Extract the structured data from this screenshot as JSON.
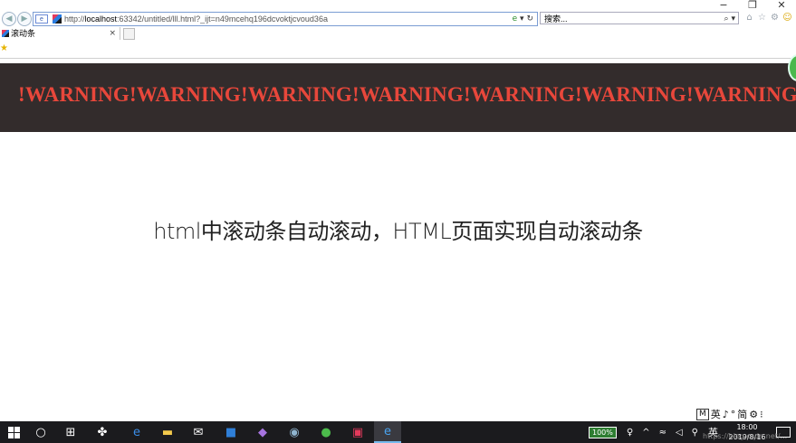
{
  "window": {
    "controls": [
      "−",
      "❐",
      "✕"
    ]
  },
  "addressbar": {
    "url_prefix": "http://",
    "url_host": "localhost",
    "url_rest": ":63342/untitled/lll.html?_ijt=n49mcehq196dcvoktjcvoud36a",
    "search_placeholder": "搜索..."
  },
  "tabs": [
    {
      "label": "滚动条"
    }
  ],
  "page": {
    "marquee_text": "!WARNING!WARNING!WARNING!WARNING!WARNING!WARNING!WARNING!WARNING",
    "headline": "html中滚动条自动滚动，HTML页面实现自动滚动条"
  },
  "ime": {
    "items": [
      "M",
      "英",
      "♪",
      "°",
      "简",
      "⚙",
      "⁝"
    ]
  },
  "taskbar": {
    "battery_label": "100%",
    "language": "英",
    "time": "18:00",
    "date": "2019/8/16"
  },
  "watermark": "https://blog.csdn.net/..."
}
